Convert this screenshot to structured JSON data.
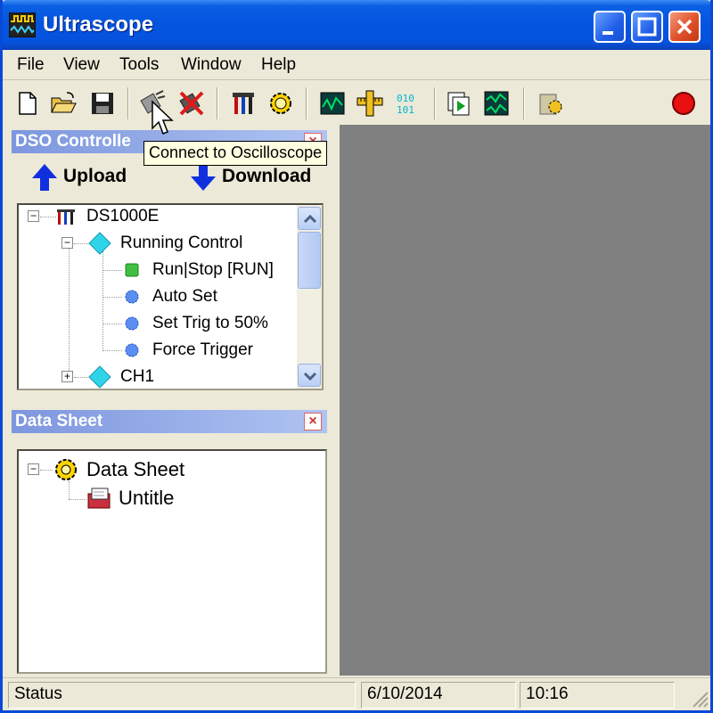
{
  "window": {
    "title": "Ultrascope"
  },
  "menu": [
    "File",
    "View",
    "Tools",
    "Window",
    "Help"
  ],
  "toolbar": {
    "tooltip": "Connect to Oscilloscope",
    "icons": [
      "new-file-icon",
      "open-folder-icon",
      "save-disk-icon",
      "connect-icon",
      "disconnect-icon",
      "tools-icon",
      "settings-gear-icon",
      "waveform-icon",
      "measure-ruler-icon",
      "binary-data-icon",
      "copy-play-icon",
      "record-waveform-icon",
      "config-icon",
      "stop-record-icon"
    ]
  },
  "dso_panel": {
    "title": "DSO Controlle",
    "upload_label": "Upload",
    "download_label": "Download",
    "tree": {
      "root": "DS1000E",
      "running_control": "Running Control",
      "items": [
        "Run|Stop [RUN]",
        "Auto Set",
        "Set Trig to 50%",
        "Force Trigger"
      ],
      "ch1": "CH1"
    }
  },
  "data_panel": {
    "title": "Data Sheet",
    "root": "Data Sheet",
    "child": "Untitle"
  },
  "status": {
    "text": "Status",
    "date": "6/10/2014",
    "time": "10:16"
  },
  "colors": {
    "titlebar": "#0554e0",
    "mdi_bg": "#808080",
    "record": "#e81010"
  }
}
